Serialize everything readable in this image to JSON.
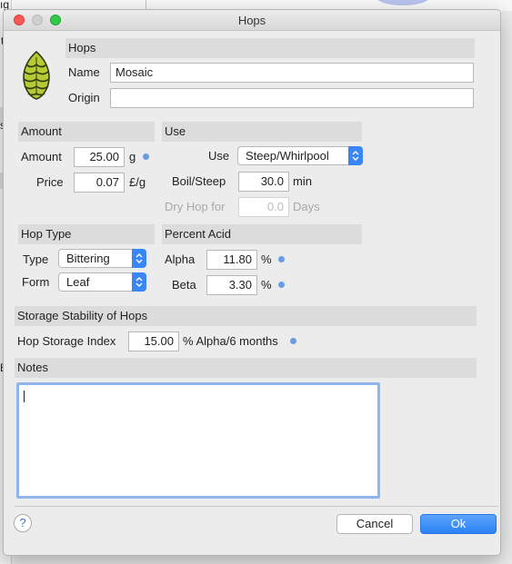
{
  "background": {
    "fragments": [
      "ıg",
      "t",
      "st",
      "Eq"
    ]
  },
  "dialog": {
    "title": "Hops",
    "header": {
      "section_label": "Hops",
      "name_label": "Name",
      "name_value": "Mosaic",
      "origin_label": "Origin",
      "origin_value": "",
      "hop_icon": "hop-cone-icon"
    },
    "amount": {
      "section_label": "Amount",
      "amount_label": "Amount",
      "amount_value": "25.00",
      "amount_unit": "g",
      "price_label": "Price",
      "price_value": "0.07",
      "price_unit": "£/g"
    },
    "use": {
      "section_label": "Use",
      "use_label": "Use",
      "use_value": "Steep/Whirlpool",
      "boil_label": "Boil/Steep",
      "boil_value": "30.0",
      "boil_unit": "min",
      "dryhop_label": "Dry Hop for",
      "dryhop_value": "0.0",
      "dryhop_unit": "Days"
    },
    "hop_type": {
      "section_label": "Hop Type",
      "type_label": "Type",
      "type_value": "Bittering",
      "form_label": "Form",
      "form_value": "Leaf"
    },
    "percent_acid": {
      "section_label": "Percent Acid",
      "alpha_label": "Alpha",
      "alpha_value": "11.80",
      "alpha_unit": "%",
      "beta_label": "Beta",
      "beta_value": "3.30",
      "beta_unit": "%"
    },
    "storage": {
      "section_label": "Storage Stability of Hops",
      "hsi_label": "Hop Storage Index",
      "hsi_value": "15.00",
      "hsi_unit": "% Alpha/6 months"
    },
    "notes": {
      "section_label": "Notes",
      "value": ""
    },
    "footer": {
      "help_label": "?",
      "cancel_label": "Cancel",
      "ok_label": "Ok"
    }
  },
  "colors": {
    "accent": "#3b86f7",
    "info_dot": "#6a9be3",
    "hop_green": "#b7c934"
  }
}
